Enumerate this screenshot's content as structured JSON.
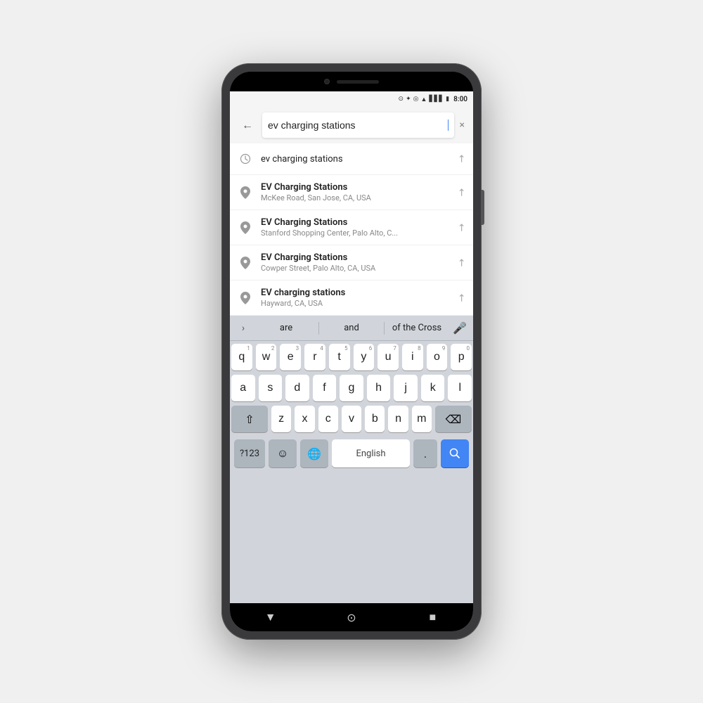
{
  "phone": {
    "status_bar": {
      "time": "8:00",
      "icons": [
        "location",
        "bluetooth",
        "target",
        "wifi",
        "signal",
        "battery"
      ]
    },
    "search": {
      "query": "ev charging stations",
      "back_label": "←",
      "clear_label": "×"
    },
    "suggestions": [
      {
        "type": "history",
        "title": "ev charging stations",
        "subtitle": "",
        "icon": "clock"
      },
      {
        "type": "place",
        "title": "EV Charging Stations",
        "subtitle": "McKee Road, San Jose, CA, USA",
        "icon": "pin"
      },
      {
        "type": "place",
        "title": "EV Charging Stations",
        "subtitle": "Stanford Shopping Center, Palo Alto, C...",
        "icon": "pin"
      },
      {
        "type": "place",
        "title": "EV Charging Stations",
        "subtitle": "Cowper Street, Palo Alto, CA, USA",
        "icon": "pin"
      },
      {
        "type": "place",
        "title": "EV charging stations",
        "subtitle": "Hayward, CA, USA",
        "icon": "pin"
      }
    ],
    "keyboard": {
      "suggestions": [
        "are",
        "and",
        "of the Cross"
      ],
      "rows": [
        [
          {
            "label": "q",
            "num": "1"
          },
          {
            "label": "w",
            "num": "2"
          },
          {
            "label": "e",
            "num": "3"
          },
          {
            "label": "r",
            "num": "4"
          },
          {
            "label": "t",
            "num": "5"
          },
          {
            "label": "y",
            "num": "6"
          },
          {
            "label": "u",
            "num": "7"
          },
          {
            "label": "i",
            "num": "8"
          },
          {
            "label": "o",
            "num": "9"
          },
          {
            "label": "p",
            "num": "0"
          }
        ],
        [
          {
            "label": "a"
          },
          {
            "label": "s"
          },
          {
            "label": "d"
          },
          {
            "label": "f"
          },
          {
            "label": "g"
          },
          {
            "label": "h"
          },
          {
            "label": "j"
          },
          {
            "label": "k"
          },
          {
            "label": "l"
          }
        ],
        [
          {
            "label": "z"
          },
          {
            "label": "x"
          },
          {
            "label": "c"
          },
          {
            "label": "v"
          },
          {
            "label": "b"
          },
          {
            "label": "n"
          },
          {
            "label": "m"
          }
        ]
      ],
      "bottom": {
        "special_label": "?123",
        "space_label": "English",
        "period_label": ".",
        "search_icon": "🔍"
      }
    },
    "nav": {
      "back": "▼",
      "home": "⊙",
      "recent": "■"
    }
  }
}
